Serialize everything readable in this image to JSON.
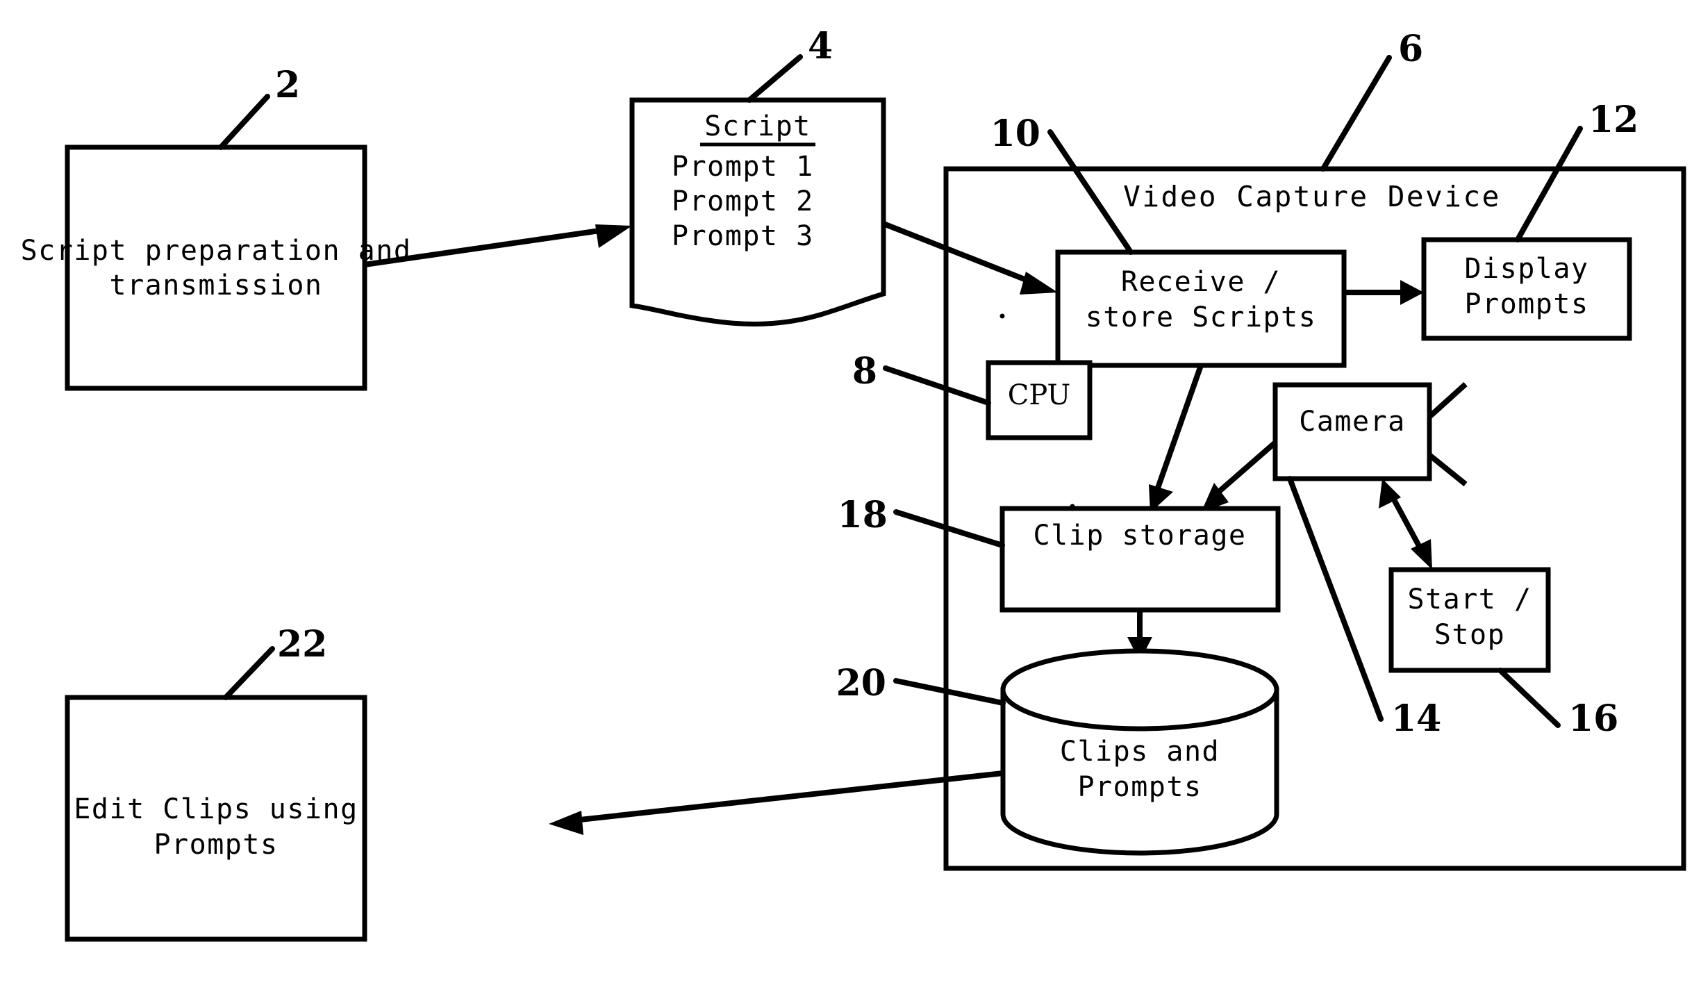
{
  "figure": {
    "type": "patent-block-diagram",
    "background_color": "#ffffff",
    "line_color": "#000000"
  },
  "blocks": {
    "script_prep": {
      "ref": "2",
      "line1": "Script preparation and",
      "line2": "transmission"
    },
    "script_doc": {
      "ref": "4",
      "title": "Script",
      "prompts": [
        "Prompt 1",
        "Prompt 2",
        "Prompt 3"
      ]
    },
    "video_capture_device": {
      "ref": "6",
      "title": "Video Capture Device"
    },
    "cpu": {
      "ref": "8",
      "label": "CPU"
    },
    "receive_store": {
      "ref": "10",
      "line1": "Receive /",
      "line2": "store Scripts"
    },
    "display_prompts": {
      "ref": "12",
      "line1": "Display",
      "line2": "Prompts"
    },
    "camera": {
      "ref": "14",
      "label": "Camera"
    },
    "start_stop": {
      "ref": "16",
      "line1": "Start /",
      "line2": "Stop"
    },
    "clip_storage": {
      "ref": "18",
      "label": "Clip storage"
    },
    "clips_and_prompts": {
      "ref": "20",
      "line1": "Clips and",
      "line2": "Prompts"
    },
    "edit_clips": {
      "ref": "22",
      "line1": "Edit Clips using",
      "line2": "Prompts"
    }
  },
  "reference_numerals": [
    "2",
    "4",
    "6",
    "8",
    "10",
    "12",
    "14",
    "16",
    "18",
    "20",
    "22"
  ]
}
